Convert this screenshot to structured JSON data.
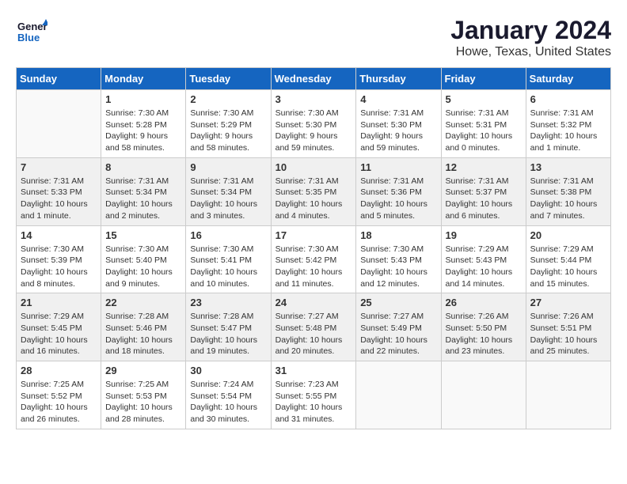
{
  "header": {
    "logo_line1": "General",
    "logo_line2": "Blue",
    "title": "January 2024",
    "subtitle": "Howe, Texas, United States"
  },
  "columns": [
    "Sunday",
    "Monday",
    "Tuesday",
    "Wednesday",
    "Thursday",
    "Friday",
    "Saturday"
  ],
  "weeks": [
    [
      {
        "num": "",
        "info": ""
      },
      {
        "num": "1",
        "info": "Sunrise: 7:30 AM\nSunset: 5:28 PM\nDaylight: 9 hours\nand 58 minutes."
      },
      {
        "num": "2",
        "info": "Sunrise: 7:30 AM\nSunset: 5:29 PM\nDaylight: 9 hours\nand 58 minutes."
      },
      {
        "num": "3",
        "info": "Sunrise: 7:30 AM\nSunset: 5:30 PM\nDaylight: 9 hours\nand 59 minutes."
      },
      {
        "num": "4",
        "info": "Sunrise: 7:31 AM\nSunset: 5:30 PM\nDaylight: 9 hours\nand 59 minutes."
      },
      {
        "num": "5",
        "info": "Sunrise: 7:31 AM\nSunset: 5:31 PM\nDaylight: 10 hours\nand 0 minutes."
      },
      {
        "num": "6",
        "info": "Sunrise: 7:31 AM\nSunset: 5:32 PM\nDaylight: 10 hours\nand 1 minute."
      }
    ],
    [
      {
        "num": "7",
        "info": "Sunrise: 7:31 AM\nSunset: 5:33 PM\nDaylight: 10 hours\nand 1 minute."
      },
      {
        "num": "8",
        "info": "Sunrise: 7:31 AM\nSunset: 5:34 PM\nDaylight: 10 hours\nand 2 minutes."
      },
      {
        "num": "9",
        "info": "Sunrise: 7:31 AM\nSunset: 5:34 PM\nDaylight: 10 hours\nand 3 minutes."
      },
      {
        "num": "10",
        "info": "Sunrise: 7:31 AM\nSunset: 5:35 PM\nDaylight: 10 hours\nand 4 minutes."
      },
      {
        "num": "11",
        "info": "Sunrise: 7:31 AM\nSunset: 5:36 PM\nDaylight: 10 hours\nand 5 minutes."
      },
      {
        "num": "12",
        "info": "Sunrise: 7:31 AM\nSunset: 5:37 PM\nDaylight: 10 hours\nand 6 minutes."
      },
      {
        "num": "13",
        "info": "Sunrise: 7:31 AM\nSunset: 5:38 PM\nDaylight: 10 hours\nand 7 minutes."
      }
    ],
    [
      {
        "num": "14",
        "info": "Sunrise: 7:30 AM\nSunset: 5:39 PM\nDaylight: 10 hours\nand 8 minutes."
      },
      {
        "num": "15",
        "info": "Sunrise: 7:30 AM\nSunset: 5:40 PM\nDaylight: 10 hours\nand 9 minutes."
      },
      {
        "num": "16",
        "info": "Sunrise: 7:30 AM\nSunset: 5:41 PM\nDaylight: 10 hours\nand 10 minutes."
      },
      {
        "num": "17",
        "info": "Sunrise: 7:30 AM\nSunset: 5:42 PM\nDaylight: 10 hours\nand 11 minutes."
      },
      {
        "num": "18",
        "info": "Sunrise: 7:30 AM\nSunset: 5:43 PM\nDaylight: 10 hours\nand 12 minutes."
      },
      {
        "num": "19",
        "info": "Sunrise: 7:29 AM\nSunset: 5:43 PM\nDaylight: 10 hours\nand 14 minutes."
      },
      {
        "num": "20",
        "info": "Sunrise: 7:29 AM\nSunset: 5:44 PM\nDaylight: 10 hours\nand 15 minutes."
      }
    ],
    [
      {
        "num": "21",
        "info": "Sunrise: 7:29 AM\nSunset: 5:45 PM\nDaylight: 10 hours\nand 16 minutes."
      },
      {
        "num": "22",
        "info": "Sunrise: 7:28 AM\nSunset: 5:46 PM\nDaylight: 10 hours\nand 18 minutes."
      },
      {
        "num": "23",
        "info": "Sunrise: 7:28 AM\nSunset: 5:47 PM\nDaylight: 10 hours\nand 19 minutes."
      },
      {
        "num": "24",
        "info": "Sunrise: 7:27 AM\nSunset: 5:48 PM\nDaylight: 10 hours\nand 20 minutes."
      },
      {
        "num": "25",
        "info": "Sunrise: 7:27 AM\nSunset: 5:49 PM\nDaylight: 10 hours\nand 22 minutes."
      },
      {
        "num": "26",
        "info": "Sunrise: 7:26 AM\nSunset: 5:50 PM\nDaylight: 10 hours\nand 23 minutes."
      },
      {
        "num": "27",
        "info": "Sunrise: 7:26 AM\nSunset: 5:51 PM\nDaylight: 10 hours\nand 25 minutes."
      }
    ],
    [
      {
        "num": "28",
        "info": "Sunrise: 7:25 AM\nSunset: 5:52 PM\nDaylight: 10 hours\nand 26 minutes."
      },
      {
        "num": "29",
        "info": "Sunrise: 7:25 AM\nSunset: 5:53 PM\nDaylight: 10 hours\nand 28 minutes."
      },
      {
        "num": "30",
        "info": "Sunrise: 7:24 AM\nSunset: 5:54 PM\nDaylight: 10 hours\nand 30 minutes."
      },
      {
        "num": "31",
        "info": "Sunrise: 7:23 AM\nSunset: 5:55 PM\nDaylight: 10 hours\nand 31 minutes."
      },
      {
        "num": "",
        "info": ""
      },
      {
        "num": "",
        "info": ""
      },
      {
        "num": "",
        "info": ""
      }
    ]
  ]
}
